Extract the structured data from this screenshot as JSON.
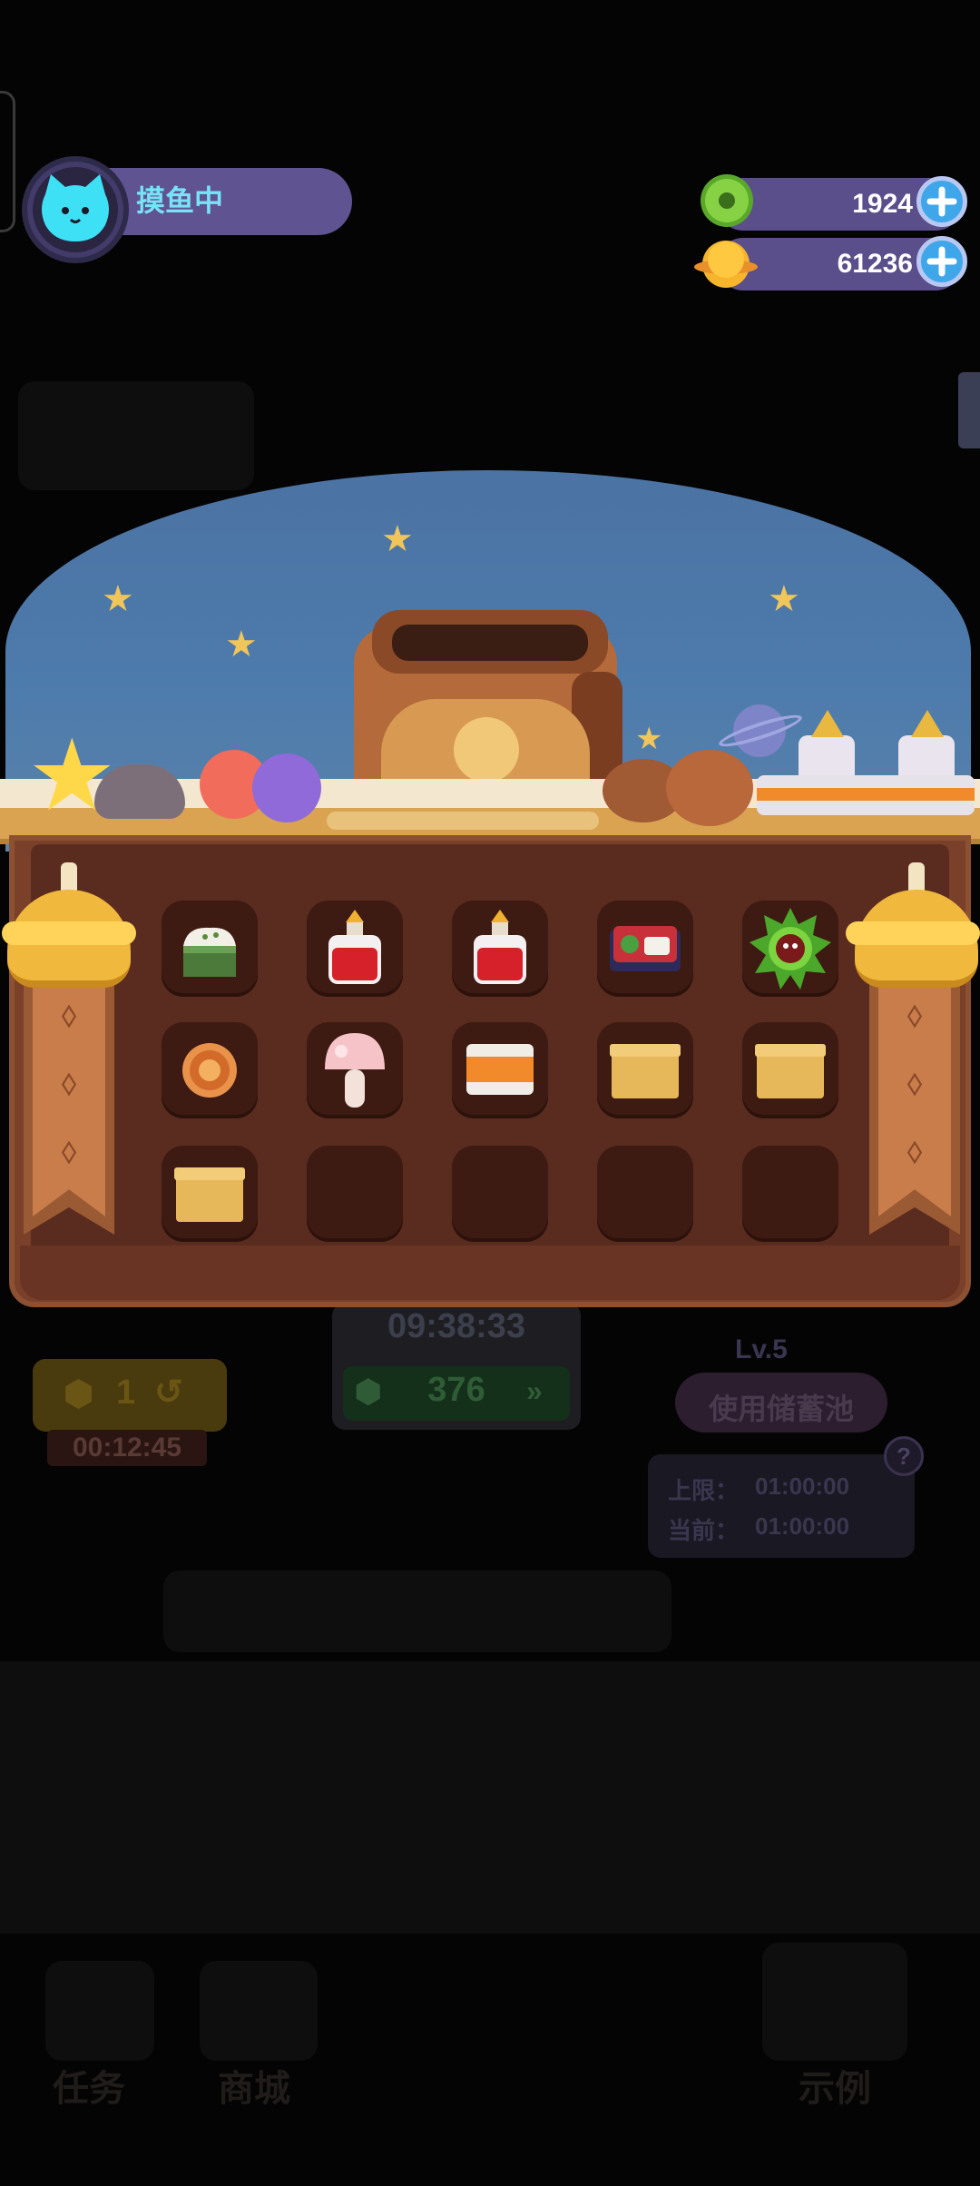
{
  "header": {
    "player_name": "摸鱼中",
    "currency_1": {
      "value": "1924",
      "icon": "donut-coin-icon",
      "color": "#6cc83a"
    },
    "currency_2": {
      "value": "61236",
      "icon": "planet-coin-icon",
      "color": "#f5b62d"
    }
  },
  "bag": {
    "title_icon": "backpack-icon",
    "slots": [
      {
        "item": "rice-cake"
      },
      {
        "item": "red-potion"
      },
      {
        "item": "red-potion"
      },
      {
        "item": "bento-box"
      },
      {
        "item": "green-spiky-creature"
      },
      {
        "item": "cookie"
      },
      {
        "item": "mushroom"
      },
      {
        "item": "canned-food"
      },
      {
        "item": "cardboard-box"
      },
      {
        "item": "cardboard-box"
      },
      {
        "item": "cardboard-box"
      },
      {
        "item": ""
      },
      {
        "item": ""
      },
      {
        "item": ""
      },
      {
        "item": ""
      }
    ]
  },
  "background_ui": {
    "left_button_count": "1",
    "left_timer": "00:12:45",
    "center_timer": "09:38:33",
    "center_value": "376",
    "level": "Lv.5",
    "storage_button": "使用储蓄池",
    "limit_label": "上限：",
    "limit_value": "01:00:00",
    "current_label": "当前：",
    "current_value": "01:00:00",
    "help": "?",
    "nav_tasks": "任务",
    "nav_shop": "商城",
    "nav_gift": "示例"
  }
}
